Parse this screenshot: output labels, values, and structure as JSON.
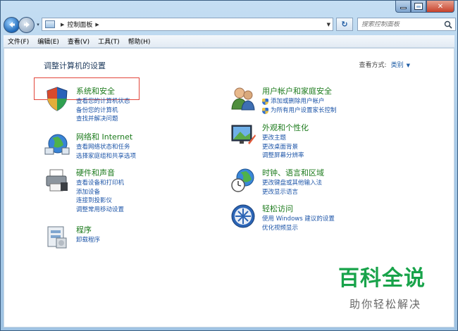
{
  "window": {
    "caption_buttons": [
      "minimize",
      "maximize",
      "close"
    ]
  },
  "address": {
    "location": "控制面板",
    "search_placeholder": "搜索控制面板"
  },
  "menubar": {
    "items": [
      "文件(F)",
      "编辑(E)",
      "查看(V)",
      "工具(T)",
      "帮助(H)"
    ]
  },
  "content": {
    "title": "调整计算机的设置",
    "view_by_label": "查看方式:",
    "view_by_value": "类别"
  },
  "categories": [
    {
      "title": "系统和安全",
      "icon": "shield-icon",
      "links": [
        "查看您的计算机状态",
        "备份您的计算机",
        "查找并解决问题"
      ]
    },
    {
      "title": "网络和 Internet",
      "icon": "network-globe-icon",
      "links": [
        "查看网络状态和任务",
        "选择家庭组和共享选项"
      ]
    },
    {
      "title": "硬件和声音",
      "icon": "printer-icon",
      "links": [
        "查看设备和打印机",
        "添加设备",
        "连接到投影仪",
        "调整常用移动设置"
      ]
    },
    {
      "title": "程序",
      "icon": "programs-icon",
      "links": [
        "卸载程序"
      ]
    },
    {
      "title": "用户帐户和家庭安全",
      "icon": "users-icon",
      "links": [
        "添加或删除用户帐户",
        "为所有用户设置家长控制"
      ]
    },
    {
      "title": "外观和个性化",
      "icon": "monitor-icon",
      "links": [
        "更改主题",
        "更改桌面背景",
        "调整屏幕分辨率"
      ]
    },
    {
      "title": "时钟、语言和区域",
      "icon": "clock-globe-icon",
      "links": [
        "更改键盘或其他输入法",
        "更改显示语言"
      ]
    },
    {
      "title": "轻松访问",
      "icon": "ease-of-access-icon",
      "links": [
        "使用 Windows 建议的设置",
        "优化视频显示"
      ]
    }
  ],
  "watermark": {
    "title": "百科全说",
    "subtitle": "助你轻松解决"
  },
  "colors": {
    "link": "#1d55a8",
    "category_title": "#1b7a1b",
    "highlight": "#e2453b"
  }
}
